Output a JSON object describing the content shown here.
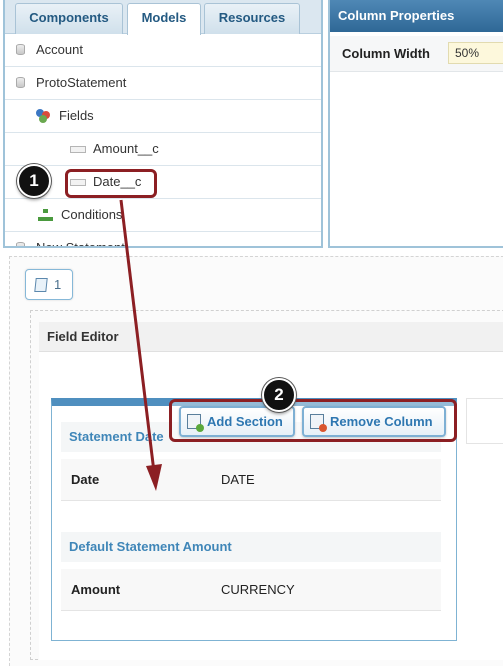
{
  "tabs": [
    {
      "label": "Components",
      "active": false
    },
    {
      "label": "Models",
      "active": true
    },
    {
      "label": "Resources",
      "active": false
    }
  ],
  "tree": {
    "items": [
      {
        "label": "Account",
        "icon": "database-icon"
      },
      {
        "label": "ProtoStatement",
        "icon": "database-icon"
      },
      {
        "label": "Fields",
        "icon": "fields-icon"
      },
      {
        "label": "Amount__c",
        "icon": "field-icon"
      },
      {
        "label": "Date__c",
        "icon": "field-icon"
      },
      {
        "label": "Conditions",
        "icon": "conditions-icon"
      },
      {
        "label": "New Statement",
        "icon": "database-icon"
      }
    ]
  },
  "column_properties": {
    "title": "Column Properties",
    "width_label": "Column Width",
    "width_value": "50%"
  },
  "canvas": {
    "page_tab_number": "1",
    "field_editor_title": "Field Editor"
  },
  "toolbar": {
    "add_section_label": "Add Section",
    "remove_column_label": "Remove Column"
  },
  "sections": [
    {
      "title": "Statement Date",
      "field": "Date",
      "type": "DATE"
    },
    {
      "title": "Default Statement Amount",
      "field": "Amount",
      "type": "CURRENCY"
    }
  ],
  "callouts": [
    "1",
    "2"
  ],
  "colors": {
    "accent_blue": "#4f8fbf",
    "callout_red": "#8c1f23",
    "header_blue": "#2f6896"
  }
}
